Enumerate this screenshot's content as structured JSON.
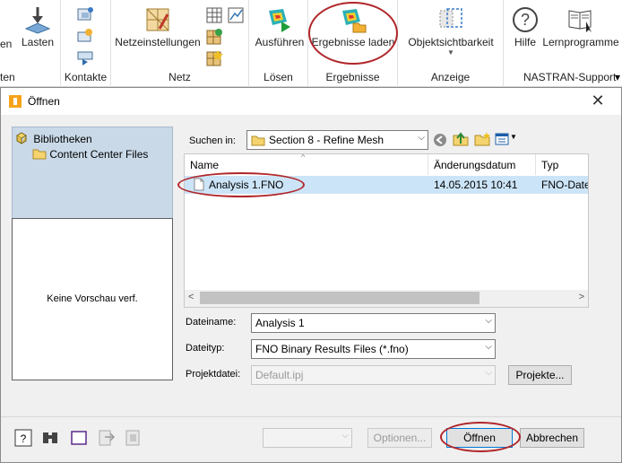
{
  "ribbon": {
    "groups": {
      "kontakte": "Kontakte",
      "netz": "Netz",
      "loesen": "Lösen",
      "ergebnisse": "Ergebnisse",
      "anzeige": "Anzeige",
      "nastran": "NASTRAN-Support"
    },
    "partial_left_label": "en",
    "partial_left_group": "ten",
    "lasten": "Lasten",
    "netzeinstellungen": "Netzeinstellungen",
    "ausfuehren": "Ausführen",
    "ergebnisse_laden": "Ergebnisse laden",
    "objektsichtbarkeit": "Objektsichtbarkeit",
    "hilfe": "Hilfe",
    "lernprogramme": "Lernprogramme",
    "nastran_dropdown": "▾"
  },
  "dialog": {
    "title": "Öffnen",
    "close": "✕",
    "places": {
      "bibliotheken": "Bibliotheken",
      "content_center": "Content Center Files"
    },
    "preview_text": "Keine Vorschau verf.",
    "suchen_in_label": "Suchen in:",
    "suchen_in_value": "Section 8 - Refine Mesh",
    "columns": {
      "name": "Name",
      "date": "Änderungsdatum",
      "type": "Typ"
    },
    "files": [
      {
        "name": "Analysis 1.FNO",
        "date": "14.05.2015 10:41",
        "type": "FNO-Datei"
      }
    ],
    "dateiname_label": "Dateiname:",
    "dateiname_value": "Analysis 1",
    "dateityp_label": "Dateityp:",
    "dateityp_value": "FNO Binary Results Files (*.fno)",
    "projektdatei_label": "Projektdatei:",
    "projektdatei_value": "Default.ipj",
    "projekte_btn": "Projekte...",
    "optionen_btn": "Optionen...",
    "oeffnen_btn": "Öffnen",
    "abbrechen_btn": "Abbrechen"
  },
  "colors": {
    "highlight": "#b0262a",
    "selection": "#cce4f7",
    "places_bg": "#c9d9e8"
  }
}
